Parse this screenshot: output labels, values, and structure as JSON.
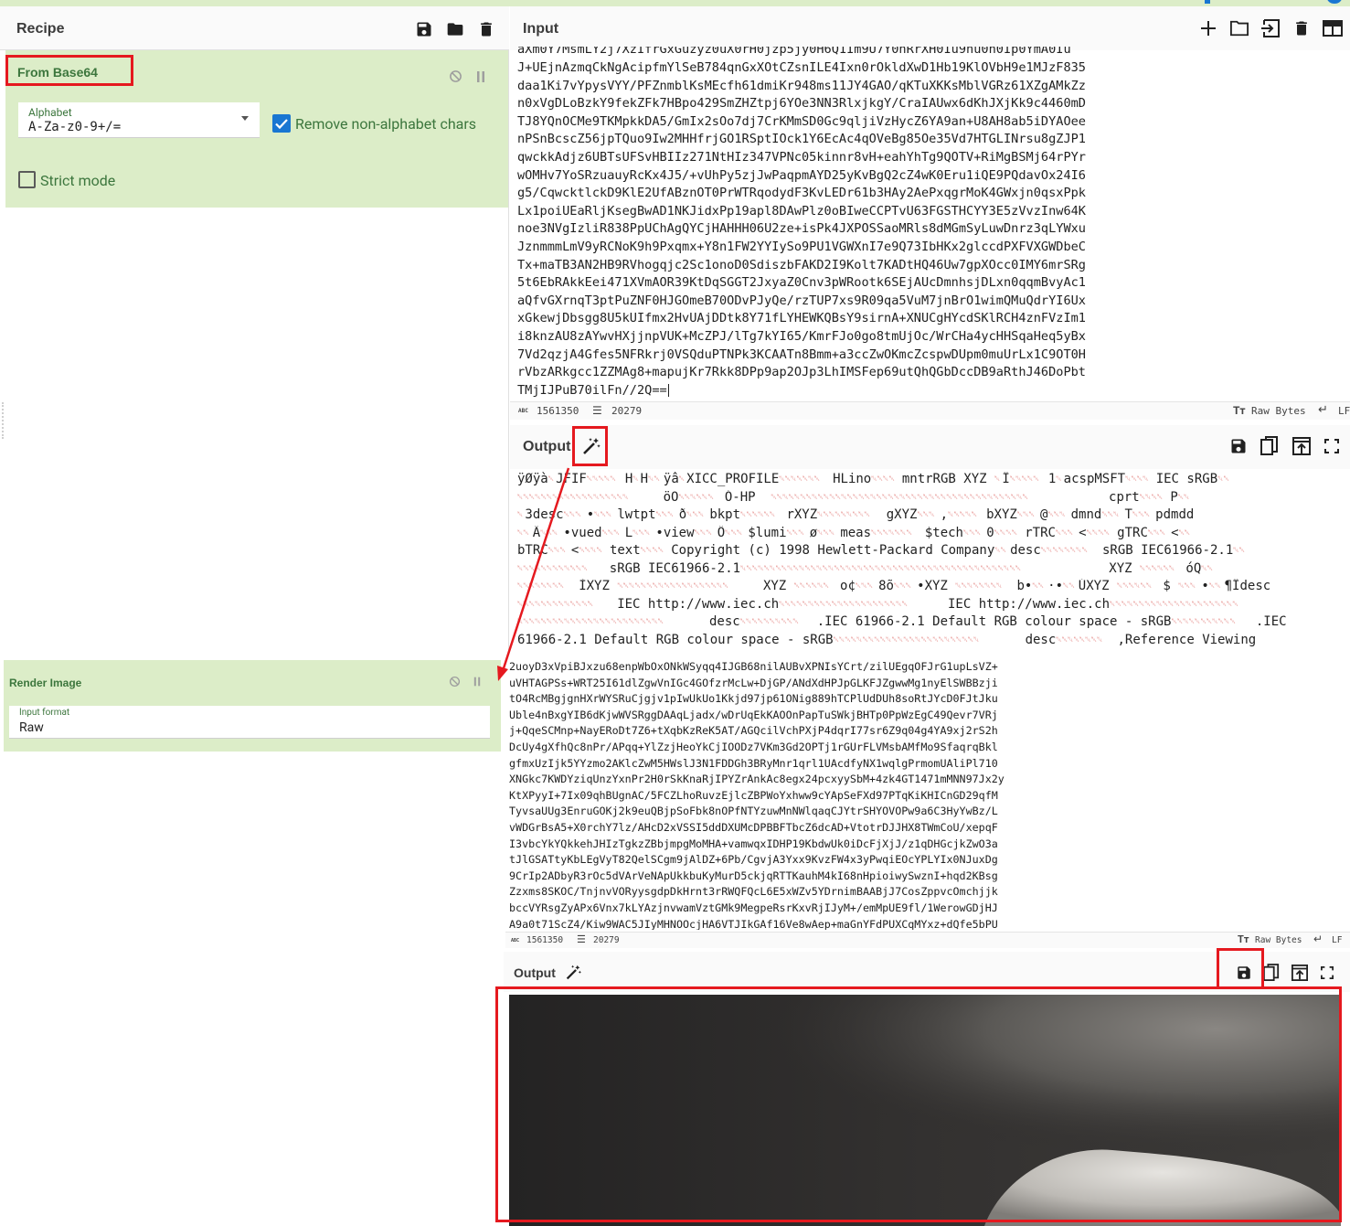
{
  "colors": {
    "accent": "#1976d2",
    "operation_bg": "#dcedc8",
    "operation_text": "#3c763d",
    "highlight_red": "#e5191f",
    "control_char_red": "#d9534f"
  },
  "recipe": {
    "title": "Recipe",
    "icons": [
      "save-icon",
      "folder-icon",
      "trash-icon"
    ],
    "operations": [
      {
        "name": "From Base64",
        "alphabet_label": "Alphabet",
        "alphabet_value": "A-Za-z0-9+/=",
        "remove_nonalpha_label": "Remove non-alphabet chars",
        "remove_nonalpha_checked": true,
        "strict_mode_label": "Strict mode",
        "strict_mode_checked": false
      },
      {
        "name": "Render Image",
        "input_format_label": "Input format",
        "input_format_value": "Raw"
      }
    ]
  },
  "input": {
    "title": "Input",
    "icons": [
      "plus-icon",
      "folder-icon",
      "open-input-icon",
      "trash-icon",
      "layout-icon"
    ],
    "lines": [
      "J+UEjnAzmqCkNgAcipfmYlSeB784qnGxXOtCZsnILE4Ixn0rOkldXwD1Hb19KlOVbH9e1MJzF835",
      "daa1Ki7vYpysVYY/PFZnmblKsMEcfh61dmiKr948ms11JY4GAO/qKTuXKKsMblVGRz61XZgAMkZz",
      "n0xVgDLoBzkY9fekZFk7HBpo429SmZHZtpj6YOe3NN3RlxjkgY/CraIAUwx6dKhJXjKk9c4460mD",
      "TJ8YQnOCMe9TKMpkkDA5/GmIx2sOo7dj7CrKMmSD0Gc9qljiVzHycZ6YA9an+U8AH8ab5iDYAOee",
      "nPSnBcscZ56jpTQuo9Iw2MHHfrjGO1RSptIOck1Y6EcAc4qOVeBg85Oe35Vd7HTGLINrsu8gZJP1",
      "qwckkAdjz6UBTsUFSvHBIIz271NtHIz347VPNc05kinnr8vH+eahYhTg9QOTV+RiMgBSMj64rPYr",
      "wOMHv7YoSRzuauyRcKx4J5/+vUhPy5zjJwPaqpmAYD25yKvBgQ2cZ4wK0Eru1iQE9PQdavOx24I6",
      "g5/CqwcktlckD9KlE2UfABznOT0PrWTRqodydF3KvLEDr61b3HAy2AePxqgrMoK4GWxjn0qsxPpk",
      "Lx1poiUEaRljKsegBwAD1NKJidxPp19apl8DAwPlz0oBIweCCPTvU63FGSTHCYY3E5zVvzInw64K",
      "noe3NVgIzliR838PpUChAgQYCjHAHHH06U2ze+isPk4JXPOSSaoMRls8dMGmSyLuwDnrz3qLYWxu",
      "JznmmmLmV9yRCNoK9h9Pxqmx+Y8n1FW2YYIySo9PU1VGWXnI7e9Q73IbHKx2glccdPXFVXGWDbeC",
      "Tx+maTB3AN2HB9RVhogqjc2Sc1onoD0SdiszbFAKD2I9Kolt7KADtHQ46Uw7gpXOcc0IMY6mrSRg",
      "5t6EbRAkkEei471XVmAOR39KtDqSGGT2JxyaZ0Cnv3pWRootk6SEjAUcDmnhsjDLxn0qqmBvyAc1",
      "aQfvGXrnqT3ptPuZNF0HJGOmeB70ODvPJyQe/rzTUP7xs9R09qa5VuM7jnBrO1wimQMuQdrYI6Ux",
      "xGkewjDbsgg8U5kUIfmx2HvUAjDDtk8Y71fLYHEWKQBsY9sirnA+XNUCgHYcdSKlRCH4znFVzIm1",
      "i8knzAU8zAYwvHXjjnpVUK+McZPJ/lTg7kYI65/KmrFJo0go8tmUjOc/WrCHa4ycHHSqaHeq5yBx",
      "7Vd2qzjA4Gfes5NFRkrj0VSQduPTNPk3KCAATn8Bmm+a3ccZwOKmcZcspwDUpm0muUrLx1C9OT0H",
      "rVbzARkgcc1ZZMAg8+mapujKr7Rkk8DPp9ap2OJp3LhIMSFep69utQhQGbDccDB9aRthJ46DoPbt",
      "TMjIJPuB70ilFn//2Q=="
    ],
    "status": {
      "length": "1561350",
      "lines": "20279",
      "encoding": "Raw Bytes",
      "eol": "LF"
    }
  },
  "output": {
    "title": "Output",
    "icons": [
      "magic-wand-icon",
      "save-icon",
      "copy-icon",
      "replace-input-icon",
      "maximize-icon"
    ],
    "lines": [
      "ÿØÿà␀JFIF␀␀␀␀␀H␀H␀␀ÿâ␀XICC_PROFILE␀␀␀␀␀␀␀HLino␀␀␀␀mntrRGB XYZ ␀Î␀␀␀␀␀1␀acspMSFT␀␀␀␀IEC sRGB␀␀",
      "␀␀␀␀␀␀␀␀␀␀␀␀␀␀␀␀␀␀␀öÖ␀␀␀␀␀␀Ó-HP  ␀␀␀␀␀␀␀␀␀␀␀␀␀␀␀␀␀␀␀␀␀␀␀␀␀␀␀␀␀␀␀␀␀␀␀␀␀␀␀␀␀␀␀␀cprt␀␀␀␀P␀␀",
      "␀3desc␀␀␀•␀␀␀lwtpt␀␀␀ð␀␀␀bkpt␀␀␀␀␀␀rXYZ␀␀␀␀␀␀␀␀␀gXYZ␀␀␀,␀␀␀␀␀bXYZ␀␀␀@␀␀␀dmnd␀␀␀T␀␀␀pdmdd",
      "␀␀Ä␀␀␀•vued␀␀␀L␀␀␀•view␀␀␀Ô␀␀␀$lumi␀␀␀ø␀␀␀meas␀␀␀␀␀␀␀$tech␀␀␀0␀␀␀␀rTRC␀␀␀<␀␀␀␀gTRC␀␀␀<␀␀",
      "bTRC␀␀␀<␀␀␀␀text␀␀␀␀Copyright (c) 1998 Hewlett-Packard Company␀␀desc␀␀␀␀␀␀␀␀sRGB IEC61966-2.1␀␀",
      "␀␀␀␀␀␀␀␀␀␀␀␀sRGB IEC61966-2.1␀␀␀␀␀␀␀␀␀␀␀␀␀␀␀␀␀␀␀␀␀␀␀␀␀␀␀␀␀␀␀␀␀␀␀␀␀␀␀␀␀␀␀␀␀␀␀␀XYZ ␀␀␀␀␀␀óQ␀␀",
      "␀␀␀␀␀␀␀␀ÌXYZ ␀␀␀␀␀␀␀␀␀␀␀␀␀␀␀␀␀␀␀XYZ ␀␀␀␀␀␀o¢␀␀␀8õ␀␀␀•XYZ ␀␀␀␀␀␀␀␀b•␀␀·•␀␀ÚXYZ ␀␀␀␀␀␀$ ␀␀␀•␀␀¶Ïdesc",
      "␀␀␀␀␀␀␀␀␀␀␀␀␀IEC http://www.iec.ch␀␀␀␀␀␀␀␀␀␀␀␀␀␀␀␀␀␀␀␀␀␀IEC http://www.iec.ch␀␀␀␀␀␀␀␀␀␀␀␀␀␀␀␀␀␀␀␀␀␀",
      "␀␀␀␀␀␀␀␀␀␀␀␀␀␀␀␀␀␀␀␀␀␀␀␀␀desc␀␀␀␀␀␀␀␀␀␀.IEC 61966-2.1 Default RGB colour space - sRGB␀␀␀␀␀␀␀␀␀␀␀.IEC",
      "61966-2.1 Default RGB colour space - sRGB␀␀␀␀␀␀␀␀␀␀␀␀␀␀␀␀␀␀␀␀␀␀␀␀␀desc␀␀␀␀␀␀␀␀,Reference Viewing"
    ]
  },
  "second_input": {
    "lines": [
      "2uoyD3xVpiBJxzu68enpWbOxONkWSyqq4IJGB68nilAUBvXPNIsYCrt/zilUEgqOFJrG1upLsVZ+",
      "uVHTAGPSs+WRT25I61dlZgwVnIGc4GOfzrMcLw+DjGP/ANdXdHPJpGLKFJZgwwMg1nyElSWBBzji",
      "tO4RcMBgjgnHXrWYSRuCjgjv1pIwUkUo1Kkjd97jp61ONig889hTCPlUdDUh8soRtJYcD0FJtJku",
      "Uble4nBxgYIB6dKjwWVSRggDAAqLjadx/wDrUqEkKAOOnPapTuSWkjBHTp0PpWzEgC49Qevr7VRj",
      "j+QqeSCMnp+NayERoDt7Z6+tXqbKzReK5AT/AGQcilVchPXjP4dqrI77sr6Z9q04g4YA9xj2rS2h",
      "DcUy4gXfhQc8nPr/APqq+YlZzjHeoYkCjIOODz7VKm3Gd2OPTj1rGUrFLVMsbAMfMo9SfaqrqBkl",
      "gfmxUzIjk5YYzmo2AKlcZwM5HWslJ3N1FDDGh3BRyMnr1qrl1UAcdfyNX1wqlgPrmomUAliPl710",
      "XNGkc7KWDYziqUnzYxnPr2H0rSkKnaRjIPYZrAnkAc8egx24pcxyySbM+4zk4GT1471mMNN97Jx2y",
      "KtXPyyI+7Ix09qhBUgnAC/5FCZLhoRuvzEjlcZBPWoYxhww9cYApSeFXd97PTqKiKHICnGD29qfM",
      "TyvsaUUg3EnruGOKj2k9euQBjpSoFbk8nOPfNTYzuwMnNWlqaqCJYtrSHYOVOPw9a6C3HyYwBz/L",
      "vWDGrBsA5+X0rchY7lz/AHcD2xVSSI5ddDXUMcDPBBFTbcZ6dcAD+VtotrDJJHX8TWmCoU/xepqF",
      "I3vbcYkYQkkehJHIzTgkzZBbjmpgMoMHA+vamwqxIDHP19KbdwUk0iDcFjXjJ/z1qDHGcjkZwO3a",
      "tJlGSATtyKbLEgVyT82QelSCgm9jAlDZ+6Pb/CgvjA3Yxx9KvzFW4x3yPwqiEOcYPLYIx0NJuxDg",
      "9CrIp2ADbyR3rOc5dVArVeNApUkkbuKyMurD5ckjqRTTKauhM4kI68nHpioiwySwznI+hqd2KBsg",
      "Zzxms8SKOC/TnjnvVORyysgdpDkHrnt3rRWQFQcL6E5xWZv5YDrnimBAABjJ7CosZppvcOmchjjk",
      "bccVYRsgZyAPx6Vnx7kLYAzjnvwamVztGMk9MegpeRsrKxvRjIJyM+/emMpUE9fl/1WerowGDjHJ",
      "A9a0t71ScZ4/Kiw9WAC5JIyMHNOOcjHA6VTJIkGAf16Ve8wAep+maGnYFdPUXCqMYxz+dQfe5bPU"
    ],
    "status": {
      "length": "1561350",
      "lines": "20279",
      "encoding": "Raw Bytes",
      "eol": "LF"
    }
  },
  "second_output": {
    "title": "Output",
    "icons": [
      "magic-wand-icon",
      "save-icon",
      "copy-icon",
      "replace-input-icon",
      "maximize-icon"
    ],
    "image_description_alt": "rendered-image"
  }
}
